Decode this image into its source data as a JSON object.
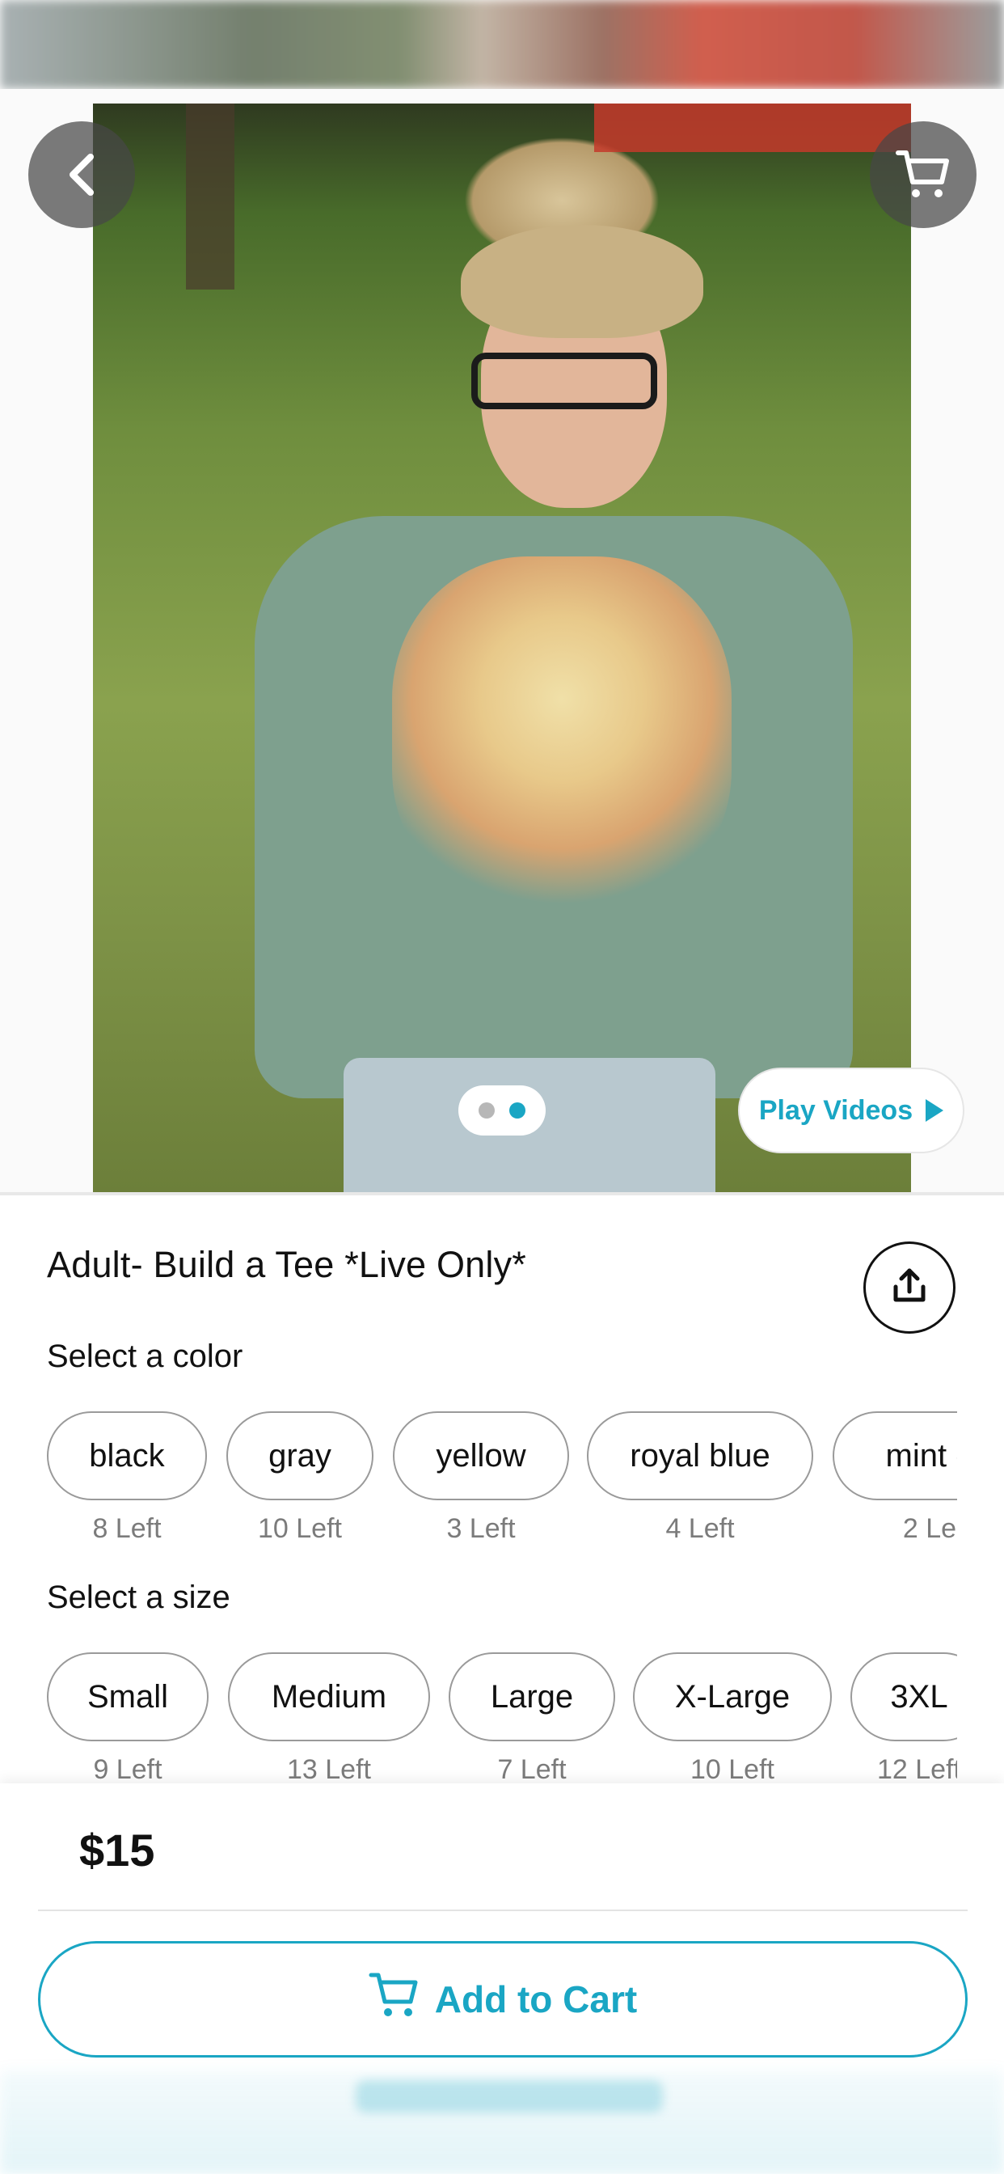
{
  "product": {
    "title": "Adult- Build a Tee *Live Only*",
    "price": "$15",
    "media_indicator": {
      "total": 2,
      "active_index": 1
    },
    "play_videos_label": "Play Videos"
  },
  "color_section": {
    "label": "Select a color",
    "options": [
      {
        "name": "black",
        "stock": "8 Left"
      },
      {
        "name": "gray",
        "stock": "10 Left"
      },
      {
        "name": "yellow",
        "stock": "3 Left"
      },
      {
        "name": "royal blue",
        "stock": "4 Left"
      },
      {
        "name": "mint g",
        "stock": "2 Le"
      }
    ]
  },
  "size_section": {
    "label": "Select a size",
    "options": [
      {
        "name": "Small",
        "stock": "9 Left"
      },
      {
        "name": "Medium",
        "stock": "13 Left"
      },
      {
        "name": "Large",
        "stock": "7 Left"
      },
      {
        "name": "X-Large",
        "stock": "10 Left"
      },
      {
        "name": "3XL",
        "stock": "12 Left"
      }
    ]
  },
  "actions": {
    "add_to_cart_label": "Add to Cart"
  },
  "icons": {
    "back": "chevron-left-icon",
    "cart": "cart-icon",
    "share": "share-icon",
    "play": "play-icon"
  },
  "colors": {
    "accent": "#1aa6c4",
    "chip_border": "#9a9a9a",
    "stock_text": "#7b7b7b",
    "overlay_button": "#464646"
  }
}
